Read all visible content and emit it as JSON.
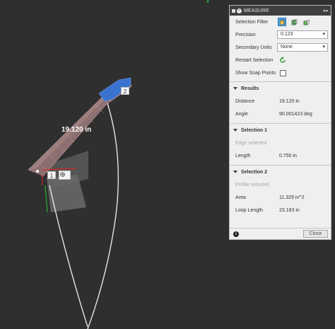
{
  "viewport": {
    "distance_label": "19.120 in",
    "point1_label": "1",
    "point2_label": "2"
  },
  "panel": {
    "title": "MEASURE",
    "selection_filter_label": "Selection Filter",
    "precision_label": "Precision",
    "precision_value": "0.123",
    "secondary_units_label": "Secondary Units",
    "secondary_units_value": "None",
    "restart_selection_label": "Restart Selection",
    "show_snap_points_label": "Show Snap Points",
    "results": {
      "title": "Results",
      "distance_label": "Distance",
      "distance_value": "19.120 in",
      "angle_label": "Angle",
      "angle_value": "90.001423 deg"
    },
    "selection1": {
      "title": "Selection 1",
      "type": "Edge selected",
      "length_label": "Length",
      "length_value": "0.750 in"
    },
    "selection2": {
      "title": "Selection 2",
      "type": "Profile selected",
      "area_label": "Area",
      "area_value": "11.329 in^2",
      "loop_length_label": "Loop Length",
      "loop_length_value": "23.183 in"
    },
    "close_label": "Close"
  },
  "colors": {
    "viewport_bg": "#2f2f2f",
    "panel_bg": "#efefef",
    "accent_blue": "#4ea0d8",
    "body_brown": "#8a6a6a",
    "selection_blue": "#2f6fd0"
  }
}
